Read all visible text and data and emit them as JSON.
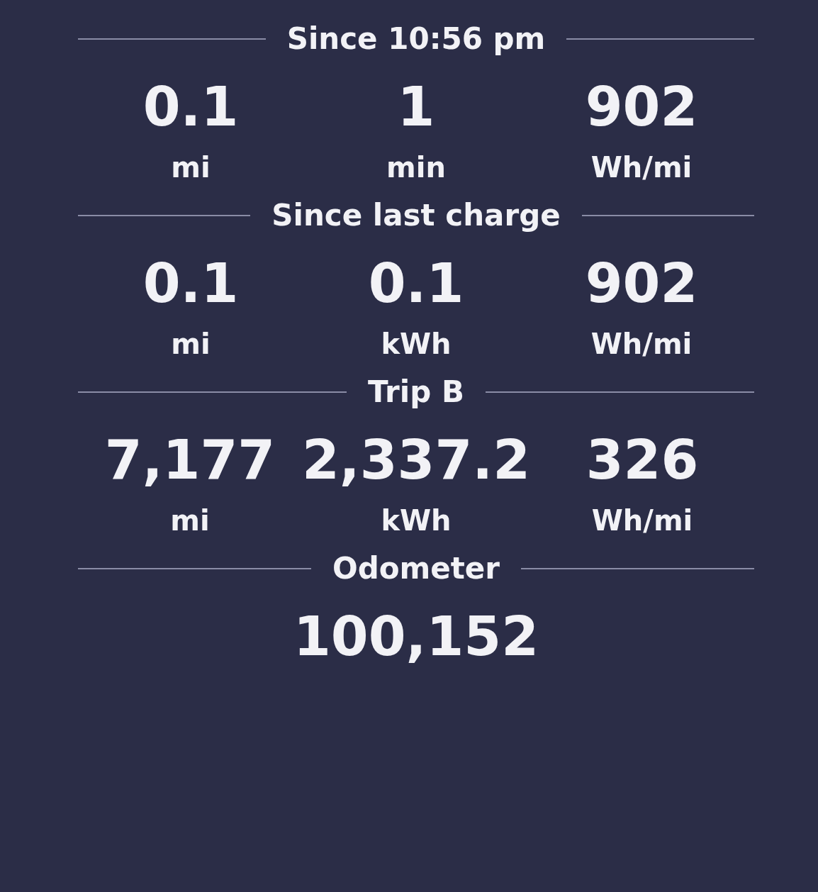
{
  "sections": [
    {
      "title": "Since 10:56 pm",
      "stats": [
        {
          "value": "0.1",
          "unit": "mi"
        },
        {
          "value": "1",
          "unit": "min"
        },
        {
          "value": "902",
          "unit": "Wh/mi"
        }
      ]
    },
    {
      "title": "Since last charge",
      "stats": [
        {
          "value": "0.1",
          "unit": "mi"
        },
        {
          "value": "0.1",
          "unit": "kWh"
        },
        {
          "value": "902",
          "unit": "Wh/mi"
        }
      ]
    },
    {
      "title": "Trip B",
      "stats": [
        {
          "value": "7,177",
          "unit": "mi"
        },
        {
          "value": "2,337.2",
          "unit": "kWh"
        },
        {
          "value": "326",
          "unit": "Wh/mi"
        }
      ]
    },
    {
      "title": "Odometer",
      "stats": [
        {
          "value": "100,152"
        }
      ]
    }
  ]
}
